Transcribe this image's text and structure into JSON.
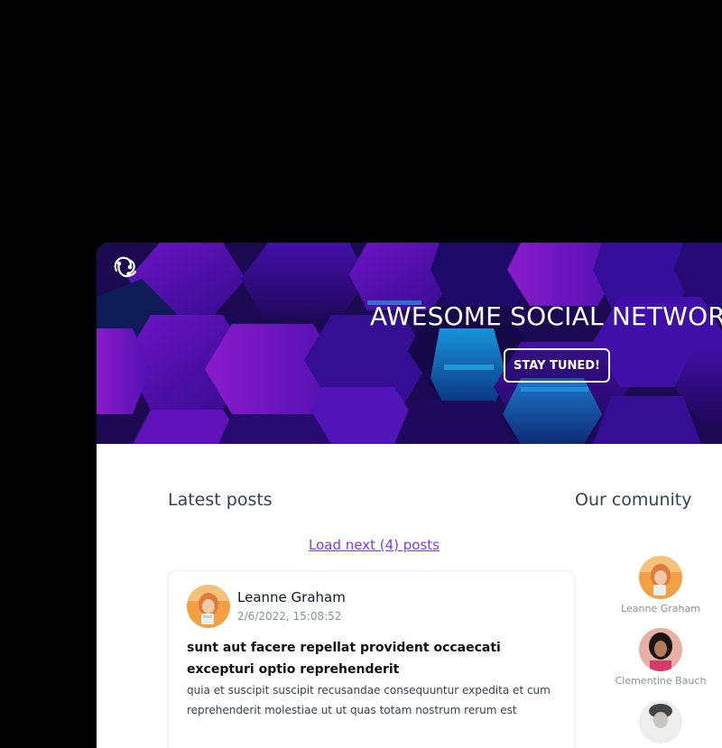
{
  "hero": {
    "title": "AWESOME SOCIAL NETWORK",
    "cta_label": "STAY TUNED!",
    "logo_icon": "redux-logo-icon",
    "background_colors": [
      "#2a0f78",
      "#5a14c8",
      "#7a0fd0",
      "#0b7fd6",
      "#1a0c5a"
    ]
  },
  "posts": {
    "title": "Latest posts",
    "load_more_label": "Load next (4) posts",
    "items": [
      {
        "author": "Leanne Graham",
        "date": "2/6/2022, 15:08:52",
        "title": "sunt aut facere repellat provident occaecati excepturi optio reprehenderit",
        "body": "quia et suscipit suscipit recusandae consequuntur expedita et cum reprehenderit molestiae ut ut quas totam nostrum rerum est"
      }
    ]
  },
  "community": {
    "title": "Our comunity",
    "members": [
      {
        "name": "Leanne Graham"
      },
      {
        "name": "Clementine Bauch"
      },
      {
        "name": ""
      }
    ]
  },
  "colors": {
    "link": "#7c3aed",
    "text": "#374151",
    "muted": "#8b8f98"
  }
}
